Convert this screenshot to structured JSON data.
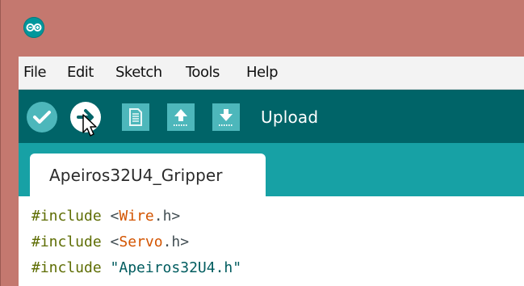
{
  "menu": {
    "items": [
      "File",
      "Edit",
      "Sketch",
      "Tools",
      "Help"
    ]
  },
  "toolbar": {
    "hover_label": "Upload",
    "buttons": [
      "verify-icon",
      "upload-icon",
      "new-icon",
      "open-icon",
      "save-icon"
    ]
  },
  "tabs": [
    {
      "label": "Apeiros32U4_Gripper"
    }
  ],
  "code": {
    "lines": [
      {
        "directive": "#include",
        "open": " <",
        "lib": "Wire",
        "close": ".h>"
      },
      {
        "directive": "#include",
        "open": " <",
        "lib": "Servo",
        "close": ".h>"
      },
      {
        "directive": "#include",
        "text": " \"Apeiros32U4.h\""
      }
    ]
  },
  "colors": {
    "titlebar": "#c4786f",
    "menubar": "#f3f3f3",
    "toolbar": "#006468",
    "tabstrip": "#17a1a5",
    "button_accent": "#4db7bb",
    "keyword": "#5e6d03",
    "library": "#d35400"
  }
}
